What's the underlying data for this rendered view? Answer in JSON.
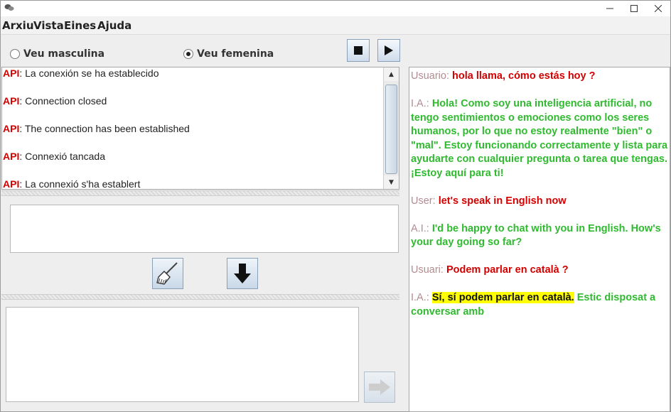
{
  "menu": [
    "Arxiu",
    "Vista",
    "Eines",
    "Ajuda"
  ],
  "voice": {
    "male_label": "Veu masculina",
    "female_label": "Veu femenina",
    "selected": "female"
  },
  "log": [
    {
      "tag": "API",
      "text": ": La conexión se ha establecido"
    },
    {
      "tag": "API",
      "text": ": Connection closed"
    },
    {
      "tag": "API",
      "text": ": The connection has been established"
    },
    {
      "tag": "API",
      "text": ": Connexió tancada"
    },
    {
      "tag": "API",
      "text": ": La connexió s'ha establert"
    }
  ],
  "input": {
    "value": ""
  },
  "prompt": {
    "value": ""
  },
  "chat": [
    {
      "speaker": "Usuario",
      "sep": ":  ",
      "text": "hola llama, cómo estás hoy ?",
      "role": "user"
    },
    {
      "speaker": "I.A.",
      "sep": ": ",
      "text": "Hola! Como soy una inteligencia artificial, no tengo sentimientos o emociones como los seres humanos, por lo que no estoy realmente \"bien\" o \"mal\". Estoy funcionando correctamente y lista para ayudarte con cualquier pregunta o tarea que tengas. ¡Estoy aquí para ti!",
      "role": "ai"
    },
    {
      "speaker": "User",
      "sep": ":  ",
      "text": "let's speak in English now",
      "role": "user"
    },
    {
      "speaker": "A.I.",
      "sep": ": ",
      "text": "I'd be happy to chat with you in English. How's your day going so far?",
      "role": "ai"
    },
    {
      "speaker": "Usuari",
      "sep": ": ",
      "text": "Podem parlar en català ?",
      "role": "user"
    },
    {
      "speaker": "I.A.",
      "sep": ": ",
      "highlight": "Sí, sí podem parlar en català.",
      "text": " Estic disposat a conversar amb",
      "role": "ai"
    }
  ],
  "colors": {
    "api_tag": "#d40000",
    "user": "#d40000",
    "ai": "#2fba2f",
    "speaker": "#b48b91",
    "highlight": "#ffff00"
  },
  "icons": {
    "stop": "stop-icon",
    "play": "play-icon",
    "clear": "broom-icon",
    "down": "arrow-down-icon",
    "send": "arrow-right-icon"
  }
}
